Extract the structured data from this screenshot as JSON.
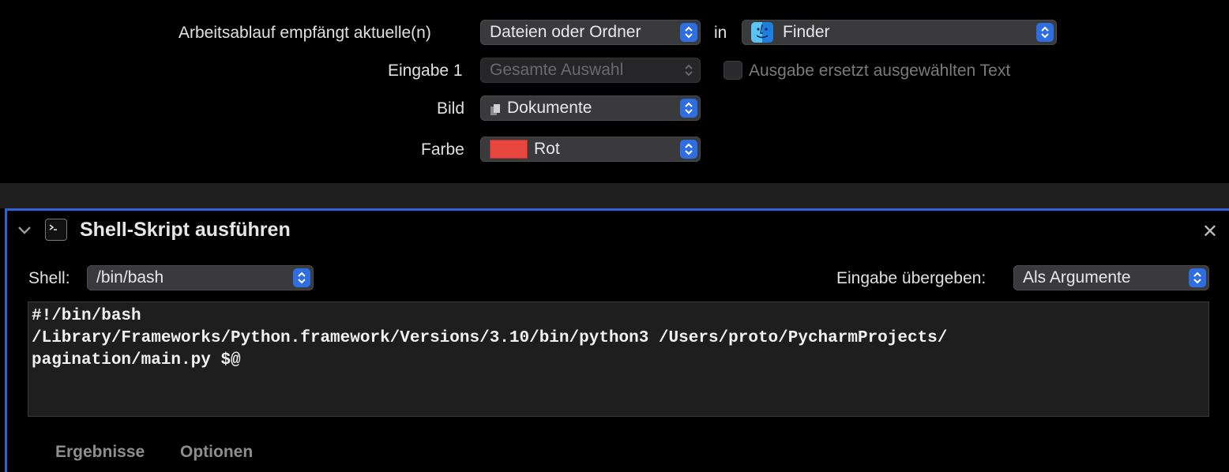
{
  "workflow": {
    "receives_label": "Arbeitsablauf empfängt aktuelle(n)",
    "receives_value": "Dateien oder Ordner",
    "in_label": "in",
    "app_value": "Finder",
    "input_label": "Eingabe 1",
    "input_value": "Gesamte Auswahl",
    "replace_label": "Ausgabe ersetzt ausgewählten Text",
    "image_label": "Bild",
    "image_value": "Dokumente",
    "color_label": "Farbe",
    "color_value": "Rot",
    "color_swatch": "#e8473f"
  },
  "action": {
    "title": "Shell-Skript ausführen",
    "close_glyph": "✕",
    "shell_label": "Shell:",
    "shell_value": "/bin/bash",
    "pass_input_label": "Eingabe übergeben:",
    "pass_input_value": "Als Argumente",
    "script_lines": [
      "#!/bin/bash",
      "/Library/Frameworks/Python.framework/Versions/3.10/bin/python3 /Users/proto/PycharmProjects/",
      "pagination/main.py $@"
    ],
    "tabs": [
      "Ergebnisse",
      "Optionen"
    ]
  },
  "colors": {
    "accent": "#2f6ee0",
    "selection_border": "#2e63d8"
  }
}
